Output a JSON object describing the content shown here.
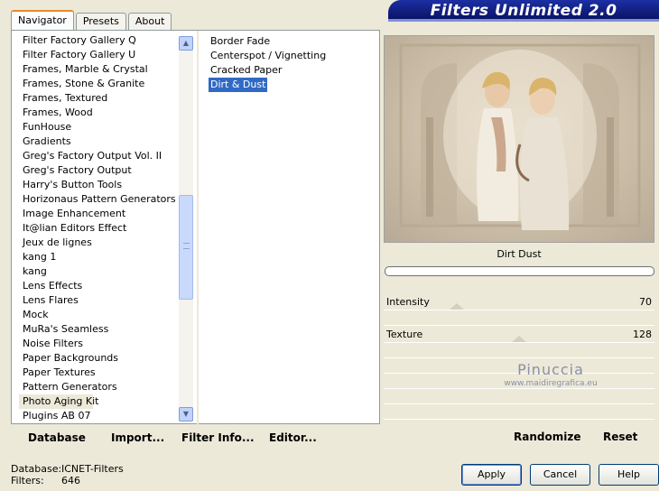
{
  "tabs": [
    {
      "label": "Navigator",
      "active": true
    },
    {
      "label": "Presets",
      "active": false
    },
    {
      "label": "About",
      "active": false
    }
  ],
  "banner": {
    "title": "Filters Unlimited 2.0"
  },
  "categories": [
    "Filter Factory Gallery Q",
    "Filter Factory Gallery U",
    "Frames, Marble & Crystal",
    "Frames, Stone & Granite",
    "Frames, Textured",
    "Frames, Wood",
    "FunHouse",
    "Gradients",
    "Greg's Factory Output Vol. II",
    "Greg's Factory Output",
    "Harry's Button Tools",
    "Horizonaus Pattern Generators",
    "Image Enhancement",
    "It@lian Editors Effect",
    "Jeux de lignes",
    "kang 1",
    "kang",
    "Lens Effects",
    "Lens Flares",
    "Mock",
    "MuRa's Seamless",
    "Noise Filters",
    "Paper Backgrounds",
    "Paper Textures",
    "Pattern Generators",
    "Photo Aging Kit",
    "Plugins AB 07"
  ],
  "selected_category_index": 25,
  "filters": [
    "Border Fade",
    "Centerspot / Vignetting",
    "Cracked Paper",
    "Dirt & Dust"
  ],
  "selected_filter_index": 3,
  "left_buttons": {
    "database": "Database",
    "import": "Import...",
    "filter_info": "Filter Info...",
    "editor": "Editor..."
  },
  "filter_panel": {
    "name": "Dirt  Dust",
    "params": [
      {
        "label": "Intensity",
        "value": "70",
        "fraction": 0.27
      },
      {
        "label": "Texture",
        "value": "128",
        "fraction": 0.5
      }
    ]
  },
  "watermark": {
    "line1": "Pinuccia",
    "line2": "www.maidiregrafica.eu"
  },
  "right_buttons": {
    "randomize": "Randomize",
    "reset": "Reset"
  },
  "status": {
    "database_label": "Database:",
    "database_value": "ICNET-Filters",
    "filters_label": "Filters:",
    "filters_value": "646"
  },
  "dialog_buttons": {
    "apply": "Apply",
    "cancel": "Cancel",
    "help": "Help"
  },
  "icons": {
    "scroll_up": "▲",
    "scroll_down": "▼"
  }
}
